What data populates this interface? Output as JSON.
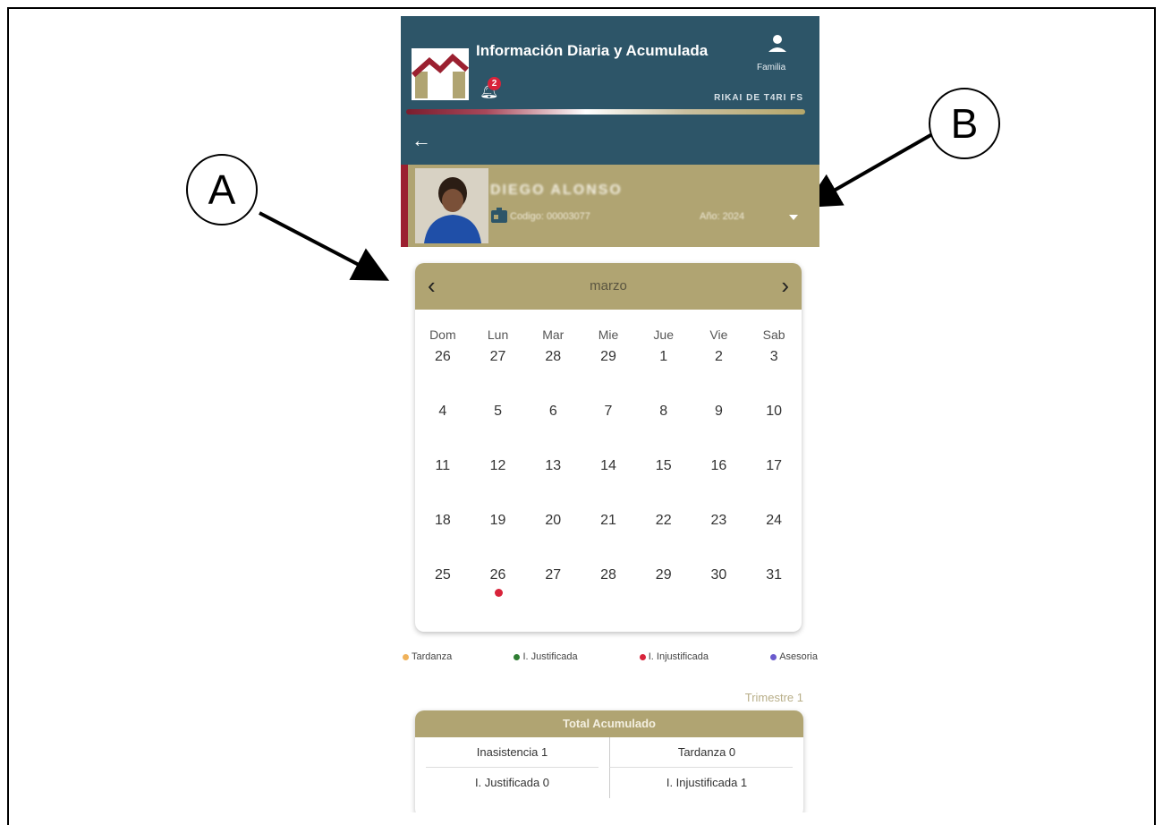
{
  "header": {
    "title": "Información Diaria y Acumulada",
    "notification_count": "2",
    "user_role": "Familia",
    "school_name": "RIKAI DE T4RI FS",
    "colors": {
      "header_bg": "#2d5568",
      "accent_gold": "#b0a472",
      "accent_red": "#9b2030"
    }
  },
  "student": {
    "name": "DIEGO ALONSO",
    "code": "Codigo: 00003077",
    "year": "Año: 2024"
  },
  "calendar": {
    "prev_icon": "‹",
    "next_icon": "›",
    "month": "marzo",
    "weekdays": [
      "Dom",
      "Lun",
      "Mar",
      "Mie",
      "Jue",
      "Vie",
      "Sab"
    ],
    "days": [
      [
        "26",
        "27",
        "28",
        "29",
        "1",
        "2",
        "3"
      ],
      [
        "4",
        "5",
        "6",
        "7",
        "8",
        "9",
        "10"
      ],
      [
        "11",
        "12",
        "13",
        "14",
        "15",
        "16",
        "17"
      ],
      [
        "18",
        "19",
        "20",
        "21",
        "22",
        "23",
        "24"
      ],
      [
        "25",
        "26",
        "27",
        "28",
        "29",
        "30",
        "31"
      ]
    ],
    "marked_day": {
      "week": 4,
      "weekday": 1,
      "status": "I. Injustificada"
    }
  },
  "legend": [
    {
      "label": "Tardanza",
      "color": "#f0b25a"
    },
    {
      "label": "I. Justificada",
      "color": "#2e7d32"
    },
    {
      "label": "I. Injustificada",
      "color": "#d8233a"
    },
    {
      "label": "Asesoria",
      "color": "#6a5acd"
    }
  ],
  "trimester": "Trimestre 1",
  "totals": {
    "title": "Total Acumulado",
    "absence": "Inasistencia 1",
    "tardiness": "Tardanza 0",
    "justified": "I. Justificada 0",
    "unjustified": "I. Injustificada 1"
  },
  "annotations": {
    "a": "A",
    "b": "B"
  }
}
